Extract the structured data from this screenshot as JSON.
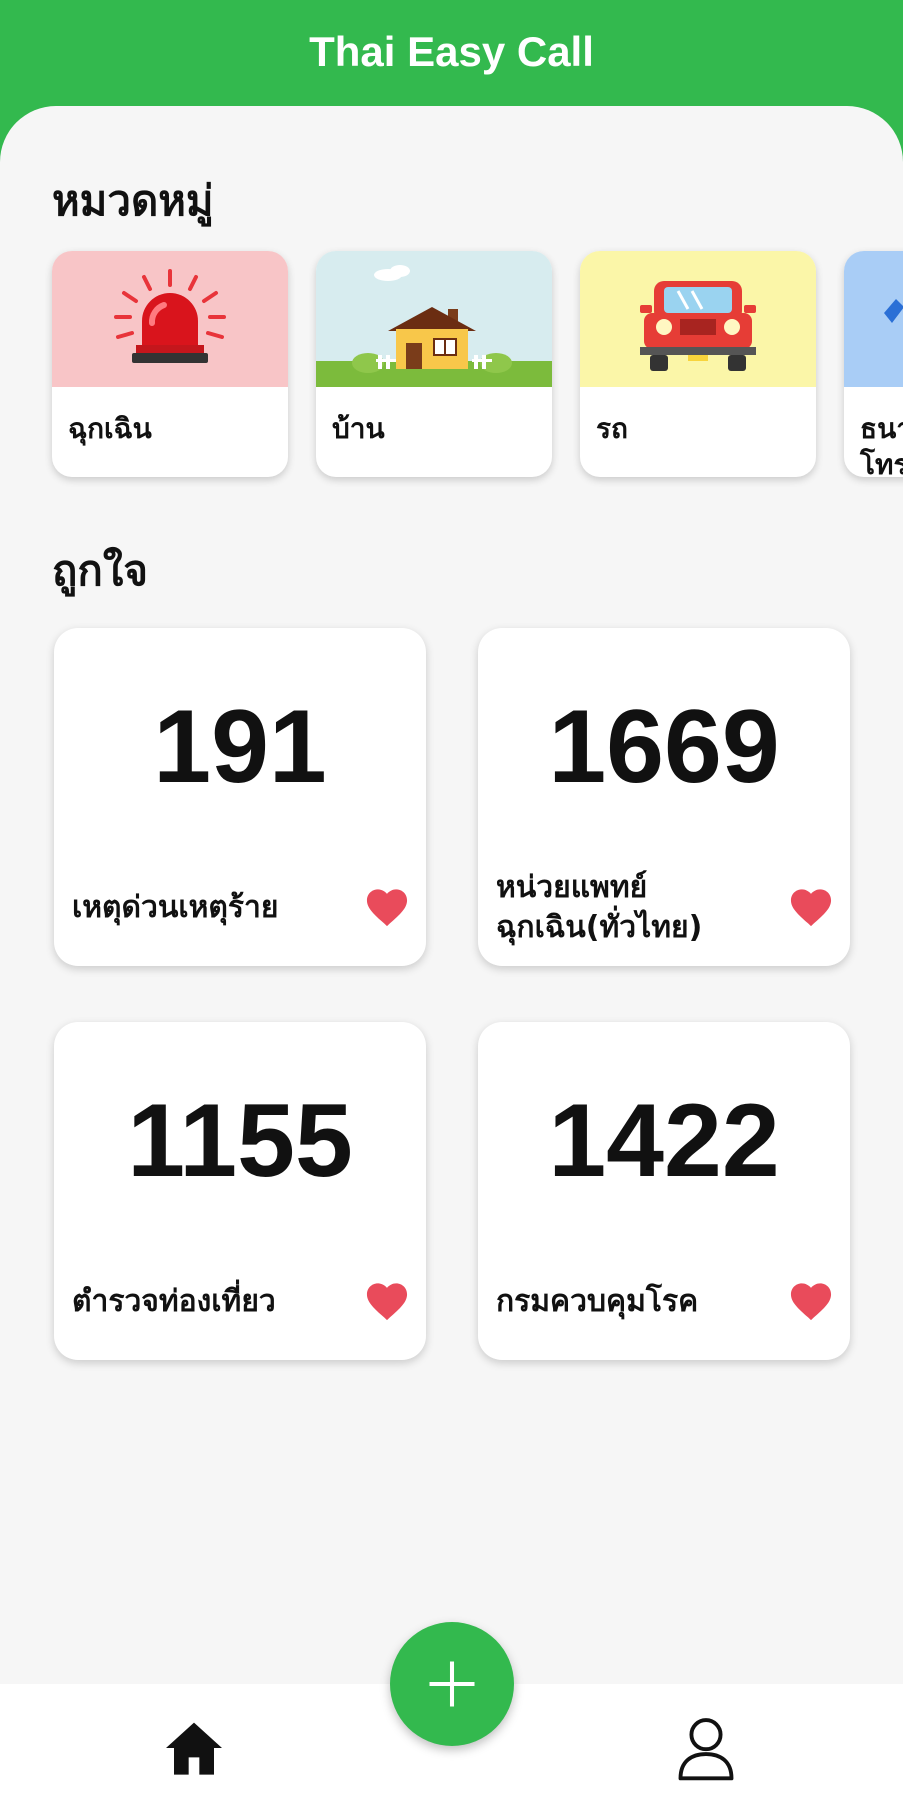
{
  "app": {
    "title": "Thai Easy Call"
  },
  "categories": {
    "heading": "หมวดหมู่",
    "items": [
      {
        "label": "ฉุกเฉิน",
        "icon": "siren-icon",
        "bg": "#f8c5c7"
      },
      {
        "label": "บ้าน",
        "icon": "house-icon",
        "bg": "#d7ecef"
      },
      {
        "label": "รถ",
        "icon": "car-icon",
        "bg": "#fbf6a8"
      },
      {
        "label": "ธนาคาร โทร",
        "icon": "bank-icon",
        "bg": "#a9cdf6"
      }
    ]
  },
  "favorites": {
    "heading": "ถูกใจ",
    "items": [
      {
        "number": "191",
        "label": "เหตุด่วนเหตุร้าย"
      },
      {
        "number": "1669",
        "label": "หน่วยแพทย์ ฉุกเฉิน(ทั่วไทย)"
      },
      {
        "number": "1155",
        "label": "ตำรวจท่องเที่ยว"
      },
      {
        "number": "1422",
        "label": "กรมควบคุมโรค"
      }
    ]
  },
  "nav": {
    "home_icon": "home-icon",
    "add_icon": "plus-icon",
    "profile_icon": "user-icon"
  },
  "colors": {
    "accent": "#33b94e",
    "heart": "#e94b5b",
    "background": "#f6f6f6"
  }
}
